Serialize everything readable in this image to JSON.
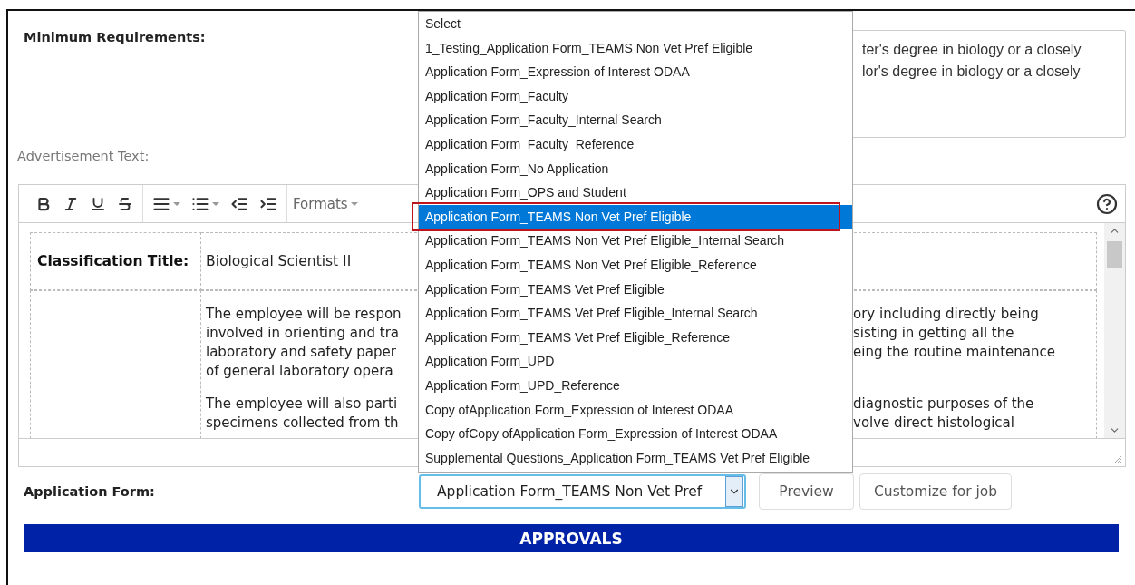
{
  "minimum_requirements": {
    "label": "Minimum Requirements:",
    "lines": [
      "ter's degree in biology or a closely",
      "lor's degree in biology or a closely"
    ]
  },
  "advertisement_text": {
    "label": "Advertisement Text:",
    "toolbar": {
      "formats": "Formats"
    },
    "classification": {
      "label": "Classification Title:",
      "value": "Biological Scientist II"
    },
    "paragraphs": [
      {
        "lines": [
          {
            "left": "The employee will be respon",
            "right": "ory including directly being"
          },
          {
            "left": "involved in orienting and tra",
            "right": "sisting in getting all the"
          },
          {
            "left": "laboratory and safety paper",
            "right": "eing the routine maintenance"
          },
          {
            "left": "of general laboratory opera"
          }
        ]
      },
      {
        "lines": [
          {
            "left": "The employee will also parti",
            "right": "diagnostic purposes of the"
          },
          {
            "left": "specimens collected from th",
            "right": "volve direct histological"
          }
        ]
      }
    ]
  },
  "application_form": {
    "label": "Application Form:",
    "value": "Application Form_TEAMS Non Vet Pref",
    "buttons": [
      "Preview",
      "Customize for job"
    ],
    "options": [
      {
        "label": "Select",
        "selected": false
      },
      {
        "label": "1_Testing_Application Form_TEAMS Non Vet Pref Eligible",
        "selected": false
      },
      {
        "label": "Application Form_Expression of Interest ODAA",
        "selected": false
      },
      {
        "label": "Application Form_Faculty",
        "selected": false
      },
      {
        "label": "Application Form_Faculty_Internal Search",
        "selected": false
      },
      {
        "label": "Application Form_Faculty_Reference",
        "selected": false
      },
      {
        "label": "Application Form_No Application",
        "selected": false
      },
      {
        "label": "Application Form_OPS and Student",
        "selected": false
      },
      {
        "label": "Application Form_TEAMS Non Vet Pref Eligible",
        "selected": true
      },
      {
        "label": "Application Form_TEAMS Non Vet Pref Eligible_Internal Search",
        "selected": false
      },
      {
        "label": "Application Form_TEAMS Non Vet Pref Eligible_Reference",
        "selected": false
      },
      {
        "label": "Application Form_TEAMS Vet Pref Eligible",
        "selected": false
      },
      {
        "label": "Application Form_TEAMS Vet Pref Eligible_Internal Search",
        "selected": false
      },
      {
        "label": "Application Form_TEAMS Vet Pref Eligible_Reference",
        "selected": false
      },
      {
        "label": "Application Form_UPD",
        "selected": false
      },
      {
        "label": "Application Form_UPD_Reference",
        "selected": false
      },
      {
        "label": "Copy ofApplication Form_Expression of Interest ODAA",
        "selected": false
      },
      {
        "label": "Copy ofCopy ofApplication Form_Expression of Interest ODAA",
        "selected": false
      },
      {
        "label": "Supplemental Questions_Application Form_TEAMS Vet Pref Eligible",
        "selected": false
      }
    ]
  },
  "approvals": {
    "title": "APPROVALS"
  }
}
